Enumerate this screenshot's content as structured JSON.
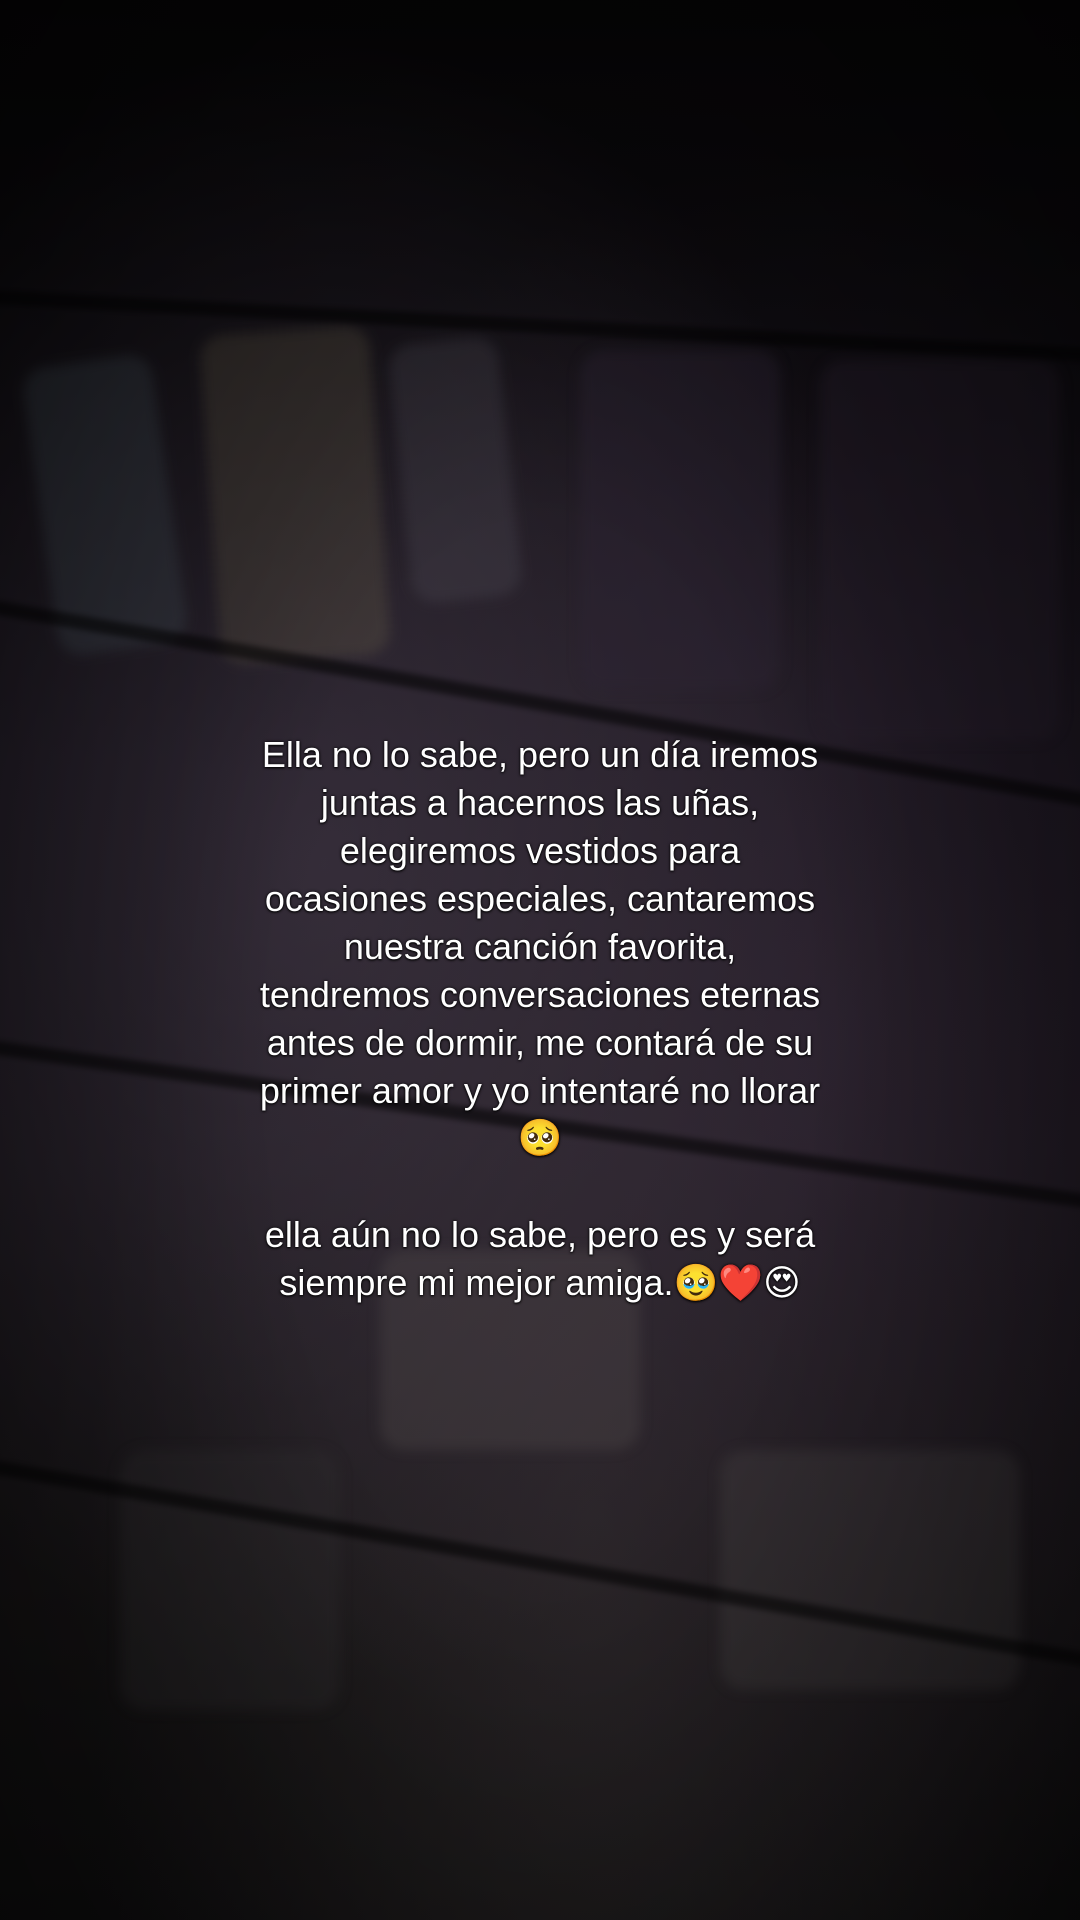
{
  "caption": {
    "line1": "Ella no lo sabe, pero un día iremos",
    "line2": "juntas a hacernos las uñas,",
    "line3": "elegiremos vestidos para",
    "line4": "ocasiones especiales, cantaremos",
    "line5": "nuestra canción favorita,",
    "line6": "tendremos conversaciones eternas",
    "line7": "antes de dormir, me contará de su",
    "line8": "primer amor y yo intentaré no llorar",
    "line9": "🥺",
    "line10": "ella aún no lo sabe, pero es y será",
    "line11": "siempre mi mejor amiga.🥹❤️😍"
  }
}
